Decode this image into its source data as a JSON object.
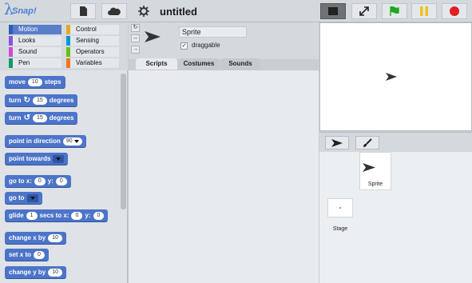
{
  "app": {
    "logo_text": "Snap!",
    "project_title": "untitled"
  },
  "categories": [
    {
      "label": "Motion",
      "color": "#4c74c9",
      "selected": true
    },
    {
      "label": "Looks",
      "color": "#8a55d7",
      "selected": false
    },
    {
      "label": "Sound",
      "color": "#cf4ad9",
      "selected": false
    },
    {
      "label": "Pen",
      "color": "#0e9a6c",
      "selected": false
    },
    {
      "label": "Control",
      "color": "#e6a822",
      "selected": false
    },
    {
      "label": "Sensing",
      "color": "#0094dd",
      "selected": false
    },
    {
      "label": "Operators",
      "color": "#62c213",
      "selected": false
    },
    {
      "label": "Variables",
      "color": "#f3761d",
      "selected": false
    }
  ],
  "palette": {
    "move": {
      "pre": "move",
      "val": "10",
      "post": "steps"
    },
    "turn_cw": {
      "pre": "turn",
      "val": "15",
      "post": "degrees"
    },
    "turn_ccw": {
      "pre": "turn",
      "val": "15",
      "post": "degrees"
    },
    "point_dir": {
      "pre": "point in direction",
      "val": "90"
    },
    "point_towards": {
      "pre": "point towards"
    },
    "goto_xy": {
      "pre": "go to x:",
      "x": "0",
      "mid": "y:",
      "y": "0"
    },
    "goto": {
      "pre": "go to"
    },
    "glide": {
      "pre": "glide",
      "secs": "1",
      "mid": "secs to x:",
      "x": "0",
      "mid2": "y:",
      "y": "0"
    },
    "change_x": {
      "pre": "change x by",
      "val": "10"
    },
    "set_x": {
      "pre": "set x to",
      "val": "0"
    },
    "change_y": {
      "pre": "change y by",
      "val": "10"
    }
  },
  "sprite": {
    "name": "Sprite",
    "draggable_label": "draggable",
    "draggable_checked": "✓"
  },
  "tabs": [
    {
      "label": "Scripts",
      "active": true
    },
    {
      "label": "Costumes",
      "active": false
    },
    {
      "label": "Sounds",
      "active": false
    }
  ],
  "corral": {
    "sprite_label": "Sprite",
    "stage_label": "Stage"
  },
  "colors": {
    "motion": "#4c74c9",
    "green_flag": "#1ea81e",
    "pause": "#f0c020",
    "stop": "#e02020"
  }
}
